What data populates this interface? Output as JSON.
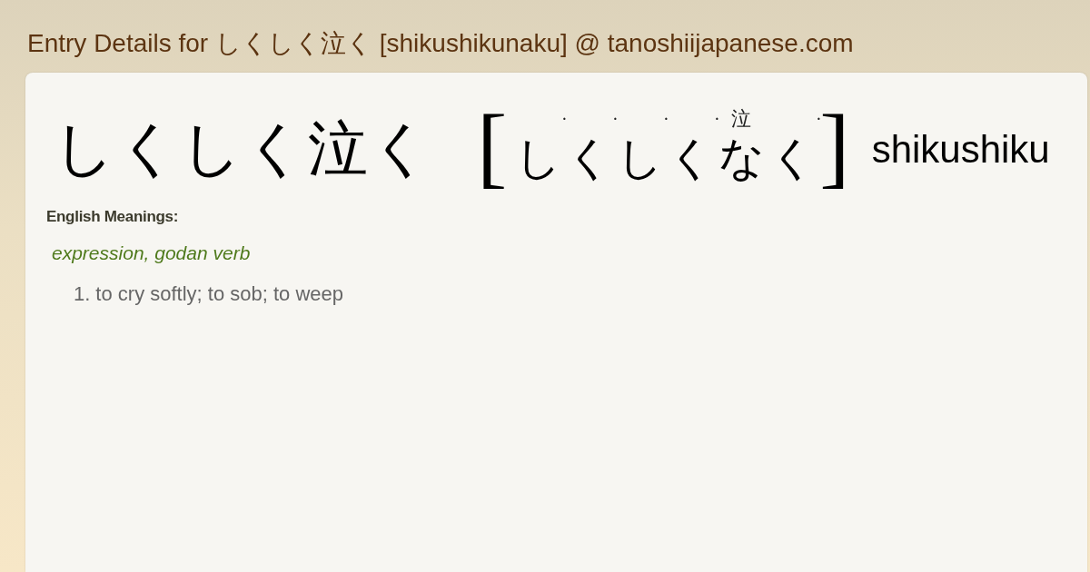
{
  "page_title": "Entry Details for しくしく泣く [shikushikunaku] @ tanoshiijapanese.com",
  "entry": {
    "headword": "しくしく泣く",
    "reading": {
      "open_bracket": "[",
      "chars": [
        {
          "kana": "し",
          "ruby": "·",
          "kind": "dot"
        },
        {
          "kana": "く",
          "ruby": "·",
          "kind": "dot"
        },
        {
          "kana": "し",
          "ruby": "·",
          "kind": "dot"
        },
        {
          "kana": "く",
          "ruby": "·",
          "kind": "dot"
        },
        {
          "kana": "な",
          "ruby": "泣",
          "kind": "kanji"
        },
        {
          "kana": "く",
          "ruby": "·",
          "kind": "dot"
        }
      ],
      "close_bracket": "]"
    },
    "romaji": "shikushiku"
  },
  "meanings": {
    "heading": "English Meanings:",
    "part_of_speech": "expression, godan verb",
    "senses": [
      {
        "number": "1.",
        "text": "to cry softly; to sob; to weep"
      }
    ]
  }
}
